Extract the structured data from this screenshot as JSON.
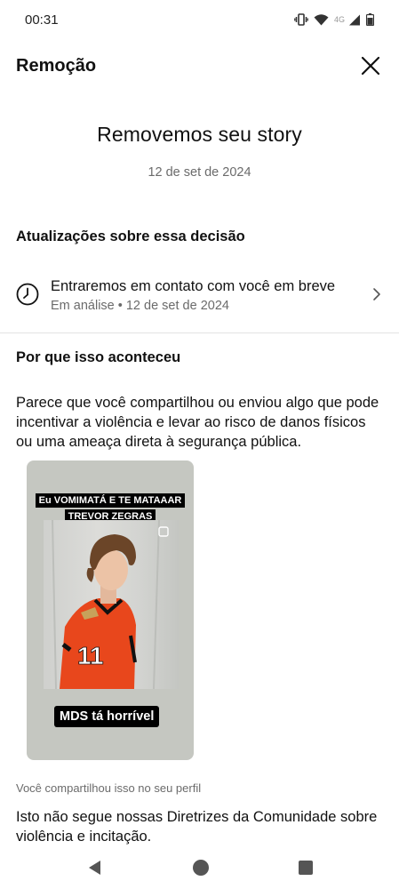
{
  "status_bar": {
    "time": "00:31",
    "network": "4G",
    "icons": [
      "vibrate-icon",
      "wifi-icon",
      "signal-icon",
      "battery-icon"
    ]
  },
  "header": {
    "title": "Remoção",
    "close_icon": "close-icon"
  },
  "main": {
    "title": "Removemos seu story",
    "date": "12 de set de 2024"
  },
  "updates": {
    "heading": "Atualizações sobre essa decisão",
    "item": {
      "icon": "clock-icon",
      "primary": "Entraremos em contato com você em breve",
      "secondary": "Em análise • 12 de set de 2024"
    }
  },
  "reason": {
    "heading": "Por que isso aconteceu",
    "explanation": "Parece que você compartilhou ou enviou algo que pode incentivar a violência e levar ao risco de danos físicos ou uma ameaça direta à segurança pública."
  },
  "story": {
    "caption_top_line1": "Eu VOMIMATÁ E TE MATAAAR",
    "caption_top_line2": "TREVOR ZEGRAS",
    "jersey_number": "11",
    "caption_bottom": "MDS tá horrível"
  },
  "footer_text": {
    "shared_note": "Você compartilhou isso no seu perfil",
    "guideline": "Isto não segue nossas Diretrizes da Comunidade sobre violência e incitação."
  },
  "colors": {
    "text_primary": "#111111",
    "text_secondary": "#6b6b6b",
    "divider": "#e3e3e3",
    "story_bg": "#c5c7c1",
    "jersey_orange": "#e8471c"
  },
  "nav": {
    "icons": [
      "back-icon",
      "home-icon",
      "recents-icon"
    ]
  }
}
